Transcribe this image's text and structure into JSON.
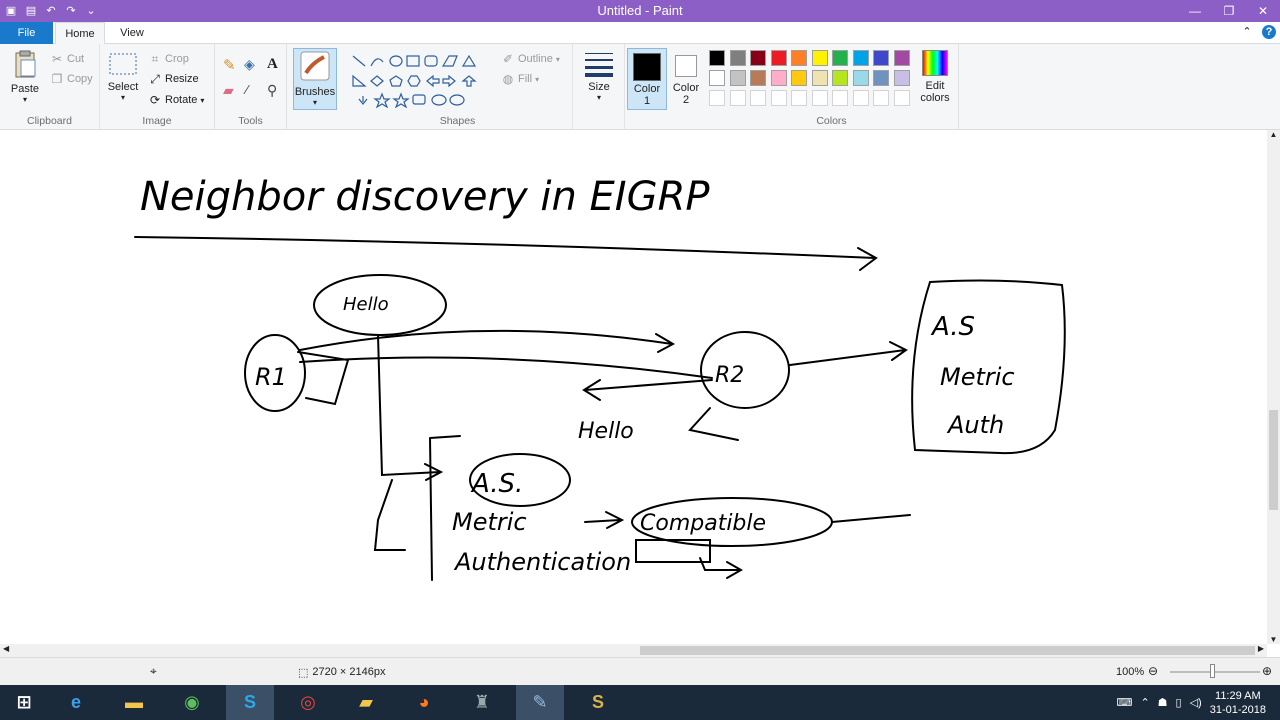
{
  "window": {
    "title": "Untitled - Paint"
  },
  "tabs": [
    {
      "label": "File"
    },
    {
      "label": "Home"
    },
    {
      "label": "View"
    }
  ],
  "ribbon": {
    "clipboard": {
      "paste": "Paste",
      "cut": "Cut",
      "copy": "Copy",
      "label": "Clipboard"
    },
    "image": {
      "select": "Select",
      "crop": "Crop",
      "resize": "Resize",
      "rotate": "Rotate",
      "label": "Image"
    },
    "tools": {
      "label": "Tools"
    },
    "brushes": {
      "label": "Brushes"
    },
    "shapes": {
      "outline": "Outline",
      "fill": "Fill",
      "label": "Shapes"
    },
    "size": {
      "label": "Size"
    },
    "color1": {
      "label": "Color",
      "num": "1",
      "color": "#000000"
    },
    "color2": {
      "label": "Color",
      "num": "2",
      "color": "#ffffff"
    },
    "colors": {
      "label": "Colors",
      "edit": "Edit",
      "edit2": "colors",
      "row1": [
        "#000000",
        "#7f7f7f",
        "#880015",
        "#ed1c24",
        "#ff7f27",
        "#fff200",
        "#22b14c",
        "#00a2e8",
        "#3f48cc",
        "#a349a4"
      ],
      "row2": [
        "#ffffff",
        "#c3c3c3",
        "#b97a57",
        "#ffaec9",
        "#ffc90e",
        "#efe4b0",
        "#b5e61d",
        "#99d9ea",
        "#7092be",
        "#c8bfe7"
      ]
    }
  },
  "canvas": {
    "heading": "Neighbor discovery in EIGRP",
    "r1": "R1",
    "r2": "R2",
    "hello_top": "Hello",
    "hello_bottom": "Hello",
    "as_box": [
      "A.S",
      "Metric",
      "Auth"
    ],
    "as_center": "A.S.",
    "metric": "Metric",
    "compatible": "Compatible",
    "authentication": "Authentication"
  },
  "statusbar": {
    "size": "2720 × 2146px",
    "zoom": "100%"
  },
  "taskbar": {
    "time": "11:29 AM",
    "date": "31-01-2018"
  }
}
